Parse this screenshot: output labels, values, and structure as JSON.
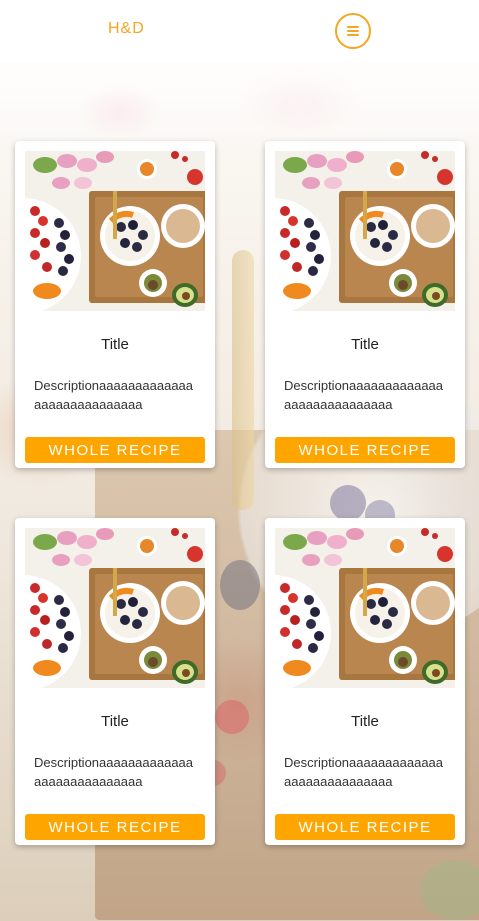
{
  "header": {
    "brand": "H&D",
    "menu_icon": "hamburger-menu-icon"
  },
  "colors": {
    "accent": "#f5a623",
    "button": "#ffa500",
    "card_bg": "#ffffff"
  },
  "cards": [
    {
      "image": "food-bowl-image",
      "title": "Title",
      "description": "Descriptionaaaaaaaaaaaaaaaaaaaaaaaaaaaa",
      "button_label": "WHOLE RECIPE"
    },
    {
      "image": "food-bowl-image",
      "title": "Title",
      "description": "Descriptionaaaaaaaaaaaaaaaaaaaaaaaaaaaa",
      "button_label": "WHOLE RECIPE"
    },
    {
      "image": "food-bowl-image",
      "title": "Title",
      "description": "Descriptionaaaaaaaaaaaaaaaaaaaaaaaaaaaa",
      "button_label": "WHOLE RECIPE"
    },
    {
      "image": "food-bowl-image",
      "title": "Title",
      "description": "Descriptionaaaaaaaaaaaaaaaaaaaaaaaaaaaa",
      "button_label": "WHOLE RECIPE"
    }
  ]
}
